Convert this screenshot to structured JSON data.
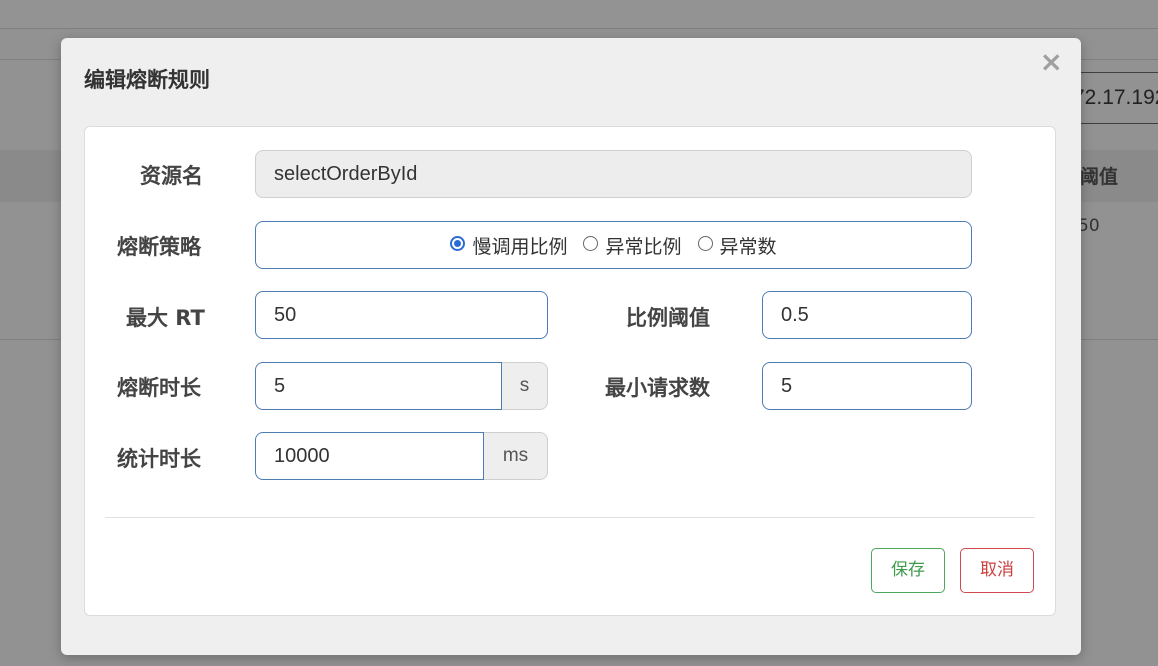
{
  "background": {
    "ip_fragment": "72.17.192",
    "column_header_fragment": "阈值",
    "cell_fragment": "50"
  },
  "modal": {
    "title": "编辑熔断规则",
    "close_label": "×"
  },
  "form": {
    "resource": {
      "label": "资源名",
      "value": "selectOrderById"
    },
    "strategy": {
      "label": "熔断策略",
      "options": [
        {
          "label": "慢调用比例",
          "checked": true
        },
        {
          "label": "异常比例",
          "checked": false
        },
        {
          "label": "异常数",
          "checked": false
        }
      ]
    },
    "max_rt": {
      "label": "最大 RT",
      "value": "50"
    },
    "ratio_threshold": {
      "label": "比例阈值",
      "value": "0.5"
    },
    "break_duration": {
      "label": "熔断时长",
      "value": "5",
      "unit": "s"
    },
    "min_request": {
      "label": "最小请求数",
      "value": "5"
    },
    "stat_duration": {
      "label": "统计时长",
      "value": "10000",
      "unit": "ms"
    }
  },
  "actions": {
    "save_label": "保存",
    "cancel_label": "取消"
  },
  "colors": {
    "accent_border": "#4f7bb3",
    "radio_checked": "#2b6bd6",
    "save": "#3f9c4c",
    "cancel": "#c9403f"
  }
}
